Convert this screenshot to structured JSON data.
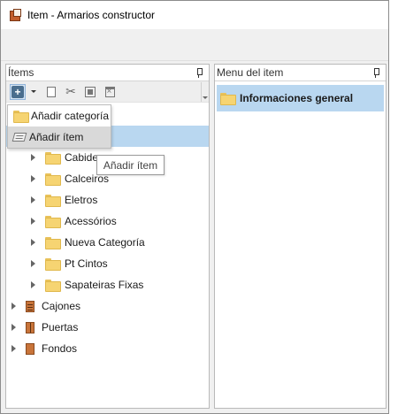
{
  "window": {
    "title": "Item - Armarios constructor"
  },
  "left_panel": {
    "header": "Ítems"
  },
  "right_panel": {
    "header": "Menu del item",
    "selected_item": "Informaciones general"
  },
  "add_menu": {
    "items": [
      {
        "label": "Añadir categoría",
        "icon": "folder-icon"
      },
      {
        "label": "Añadir ítem",
        "icon": "item-icon"
      }
    ]
  },
  "tooltip": {
    "text": "Añadir ítem"
  },
  "tree": {
    "subcategories": [
      {
        "label": "Cabide"
      },
      {
        "label": "Calceiros"
      },
      {
        "label": "Eletros"
      },
      {
        "label": "Acessórios"
      },
      {
        "label": "Nueva Categoría"
      },
      {
        "label": "Pt Cintos"
      },
      {
        "label": "Sapateiras Fixas"
      }
    ],
    "categories": [
      {
        "label": "Cajones",
        "icon": "drawer-cabinet-icon"
      },
      {
        "label": "Puertas",
        "icon": "door-cabinet-icon"
      },
      {
        "label": "Fondos",
        "icon": "back-panel-icon"
      }
    ]
  },
  "colors": {
    "selection": "#b9d7f0",
    "folder": "#f6d472",
    "cabinet": "#c8743a"
  }
}
